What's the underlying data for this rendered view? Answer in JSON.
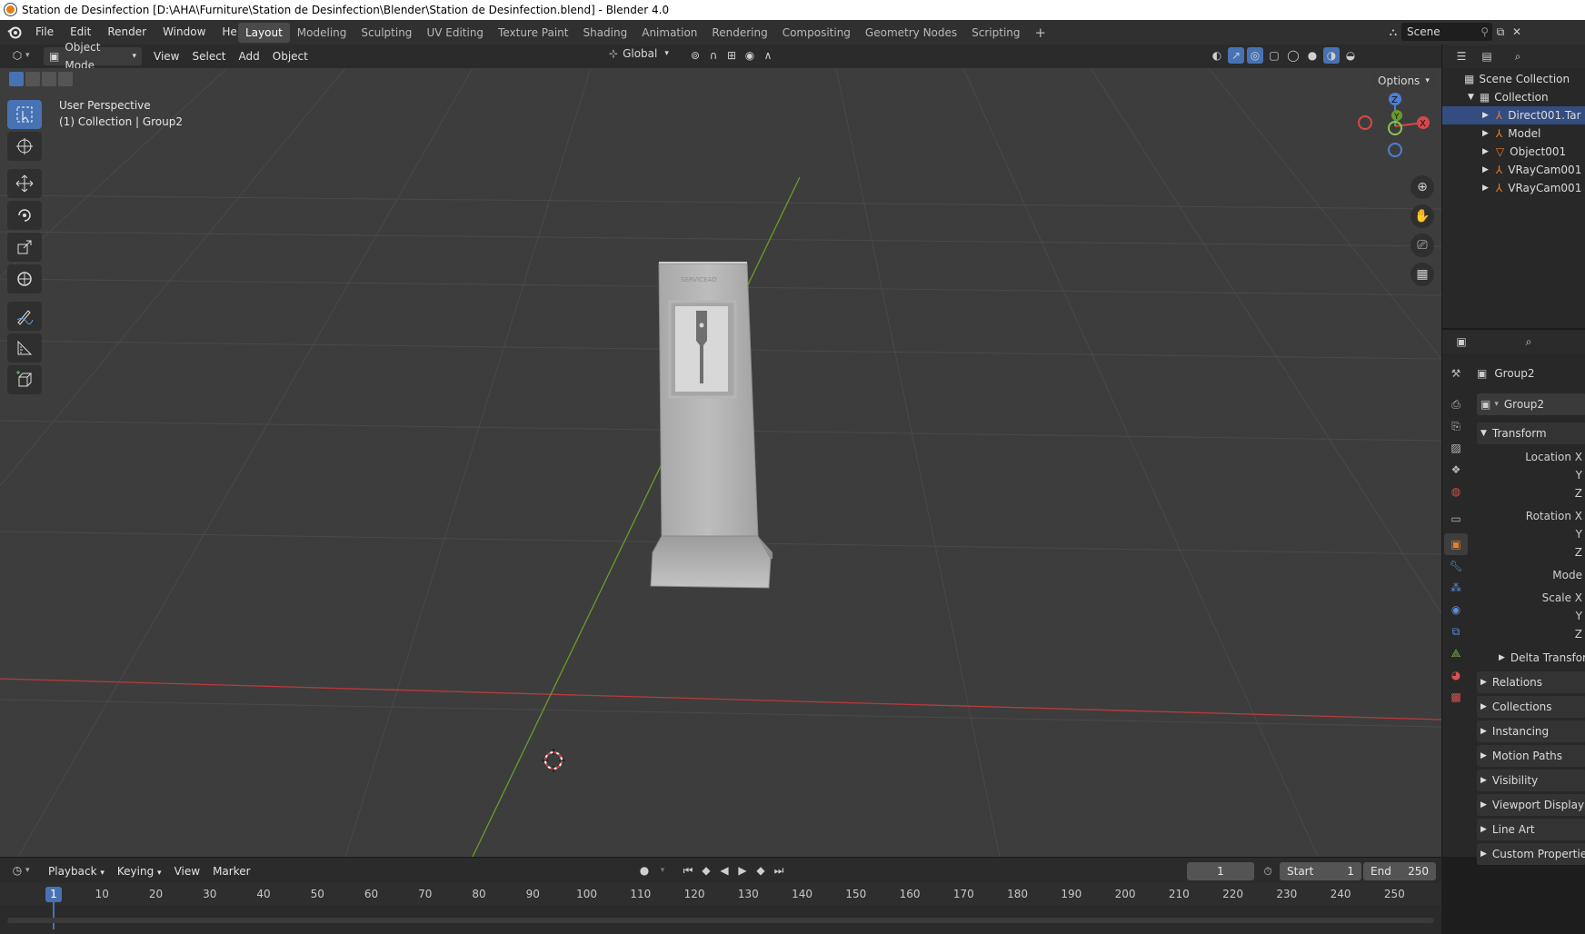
{
  "window": {
    "title": "Station de Desinfection [D:\\AHA\\Furniture\\Station de Desinfection\\Blender\\Station de Desinfection.blend] - Blender 4.0"
  },
  "menu": [
    "File",
    "Edit",
    "Render",
    "Window",
    "Help"
  ],
  "workspaces": [
    "Layout",
    "Modeling",
    "Sculpting",
    "UV Editing",
    "Texture Paint",
    "Shading",
    "Animation",
    "Rendering",
    "Compositing",
    "Geometry Nodes",
    "Scripting"
  ],
  "active_workspace": "Layout",
  "scene": {
    "name": "Scene"
  },
  "viewport_header": {
    "mode": "Object Mode",
    "menus": [
      "View",
      "Select",
      "Add",
      "Object"
    ],
    "orientation": "Global",
    "options_label": "Options"
  },
  "viewport": {
    "perspective": "User Perspective",
    "context": "(1) Collection | Group2",
    "object_logo_text": "SERVICEAD",
    "gizmo": {
      "x": "X",
      "y": "Y",
      "z": "Z"
    }
  },
  "outliner": {
    "root": "Scene Collection",
    "collection": "Collection",
    "items": [
      {
        "label": "Direct001.Tar",
        "icon": "empty-icon",
        "selected": true
      },
      {
        "label": "Model",
        "icon": "empty-icon",
        "selected": false
      },
      {
        "label": "Object001",
        "icon": "mesh-icon",
        "selected": false
      },
      {
        "label": "VRayCam001",
        "icon": "empty-icon",
        "selected": false
      },
      {
        "label": "VRayCam001",
        "icon": "empty-icon",
        "selected": false
      }
    ]
  },
  "properties": {
    "header_name": "Group2",
    "object_name": "Group2",
    "transform_title": "Transform",
    "location_labels": [
      "Location X",
      "Y",
      "Z"
    ],
    "rotation_labels": [
      "Rotation X",
      "Y",
      "Z"
    ],
    "mode_label": "Mode",
    "scale_labels": [
      "Scale X",
      "Y",
      "Z"
    ],
    "delta_transform": "Delta Transform",
    "panels": [
      "Relations",
      "Collections",
      "Instancing",
      "Motion Paths",
      "Visibility",
      "Viewport Display",
      "Line Art",
      "Custom Properties"
    ]
  },
  "timeline": {
    "menus": [
      "Playback",
      "Keying",
      "View",
      "Marker"
    ],
    "current_frame": "1",
    "start_label": "Start",
    "start": "1",
    "end_label": "End",
    "end": "250",
    "ruler": [
      "1",
      "10",
      "20",
      "30",
      "40",
      "50",
      "60",
      "70",
      "80",
      "90",
      "100",
      "110",
      "120",
      "130",
      "140",
      "150",
      "160",
      "170",
      "180",
      "190",
      "200",
      "210",
      "220",
      "230",
      "240",
      "250"
    ]
  },
  "colors": {
    "accent": "#4772b3",
    "viewport_bg": "#3d3d3d",
    "x_axis": "#b83b3b",
    "y_axis": "#6a9b2a",
    "selection_orange": "#e8802a"
  }
}
